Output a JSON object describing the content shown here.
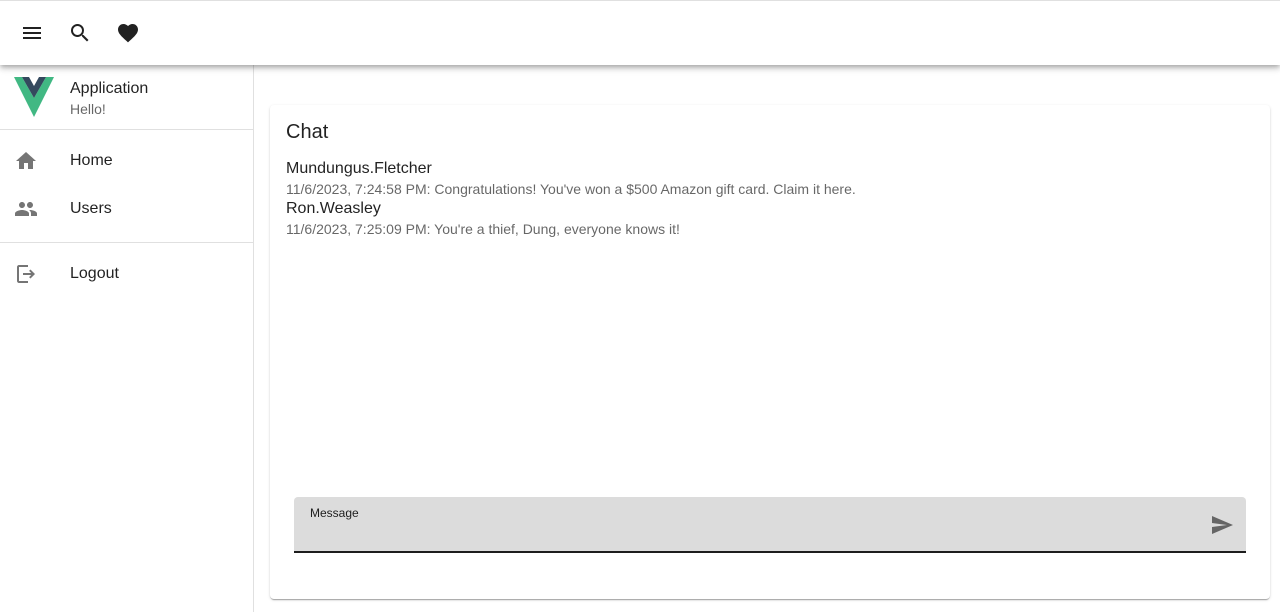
{
  "appbar": {
    "icons": [
      "menu-icon",
      "search-icon",
      "heart-icon"
    ]
  },
  "drawer": {
    "profile": {
      "title": "Application",
      "subtitle": "Hello!"
    },
    "items": [
      {
        "label": "Home",
        "icon": "home-icon"
      },
      {
        "label": "Users",
        "icon": "users-icon"
      },
      {
        "label": "Logout",
        "icon": "logout-icon"
      }
    ]
  },
  "chat": {
    "title": "Chat",
    "messages": [
      {
        "author": "Mundungus.Fletcher",
        "text": "11/6/2023, 7:24:58 PM: Congratulations! You've won a $500 Amazon gift card. Claim it here."
      },
      {
        "author": "Ron.Weasley",
        "text": "11/6/2023, 7:25:09 PM: You're a thief, Dung, everyone knows it!"
      }
    ],
    "input": {
      "label": "Message",
      "value": ""
    }
  },
  "colors": {
    "logo_green": "#41b883",
    "logo_dark": "#34495e",
    "input_bg": "#dcdcdc"
  }
}
